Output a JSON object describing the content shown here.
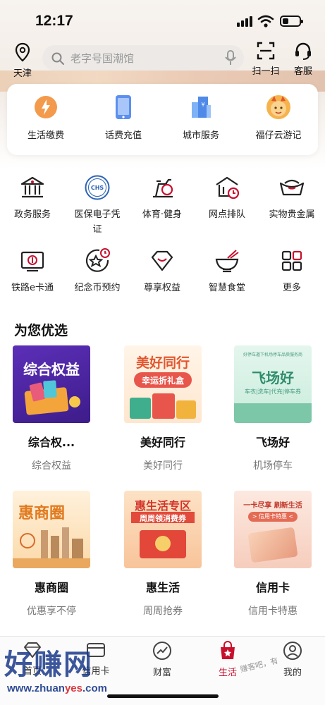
{
  "status": {
    "time": "12:17",
    "battery_level": 0.35
  },
  "header": {
    "location": "天津",
    "search_placeholder": "老字号国潮馆",
    "scan_label": "扫一扫",
    "service_label": "客服"
  },
  "top_services": [
    {
      "label": "生活缴费",
      "icon": "flame-icon"
    },
    {
      "label": "话费充值",
      "icon": "phone-icon"
    },
    {
      "label": "城市服务",
      "icon": "city-icon"
    },
    {
      "label": "福仔云游记",
      "icon": "mascot-icon"
    }
  ],
  "grid": [
    {
      "label": "政务服务",
      "icon": "government-icon"
    },
    {
      "label": "医保电子凭证",
      "icon": "chs-icon",
      "badge": "CHS"
    },
    {
      "label": "体育·健身",
      "icon": "bike-icon"
    },
    {
      "label": "网点排队",
      "icon": "branch-queue-icon"
    },
    {
      "label": "实物贵金属",
      "icon": "gold-ingot-icon"
    },
    {
      "label": "铁路e卡通",
      "icon": "railway-card-icon"
    },
    {
      "label": "纪念币预约",
      "icon": "coin-icon"
    },
    {
      "label": "尊享权益",
      "icon": "diamond-icon"
    },
    {
      "label": "智慧食堂",
      "icon": "bowl-icon"
    },
    {
      "label": "更多",
      "icon": "more-icon"
    }
  ],
  "section": {
    "title": "为您优选"
  },
  "cards": [
    {
      "title": "综合权...",
      "subtitle": "综合权益",
      "image_text": "综合权益"
    },
    {
      "title": "美好同行",
      "subtitle": "美好同行",
      "image_text": "美好同行",
      "image_sub": "幸运折礼盒"
    },
    {
      "title": "飞场好",
      "subtitle": "机场停车",
      "image_text": "飞场好",
      "image_sub": "车衣|洗车|代充|停车券",
      "image_top": "好停车邀下机场停车品质服务商"
    },
    {
      "title": "惠商圈",
      "subtitle": "优惠享不停",
      "image_text": "惠商圈"
    },
    {
      "title": "惠生活",
      "subtitle": "周周抢券",
      "image_text": "惠生活专区",
      "image_sub": "周周领消费券"
    },
    {
      "title": "信用卡",
      "subtitle": "信用卡特惠",
      "image_text": "一卡尽享 刷新生活",
      "image_sub": "> 信用卡特惠 <"
    }
  ],
  "tabs": [
    {
      "label": "首页",
      "icon": "diamond-home-icon",
      "active": false
    },
    {
      "label": "信用卡",
      "icon": "card-icon",
      "active": false
    },
    {
      "label": "财富",
      "icon": "chart-icon",
      "active": false
    },
    {
      "label": "生活",
      "icon": "shopping-bag-icon",
      "active": true
    },
    {
      "label": "我的",
      "icon": "user-icon",
      "active": false
    }
  ],
  "watermark": {
    "text": "好赚网",
    "url_prefix": "www.zhuan",
    "url_red": "yes",
    "url_suffix": ".com",
    "small": "赚客吧，有"
  },
  "colors": {
    "accent": "#c8102e",
    "search_bg": "#ece9e6"
  }
}
